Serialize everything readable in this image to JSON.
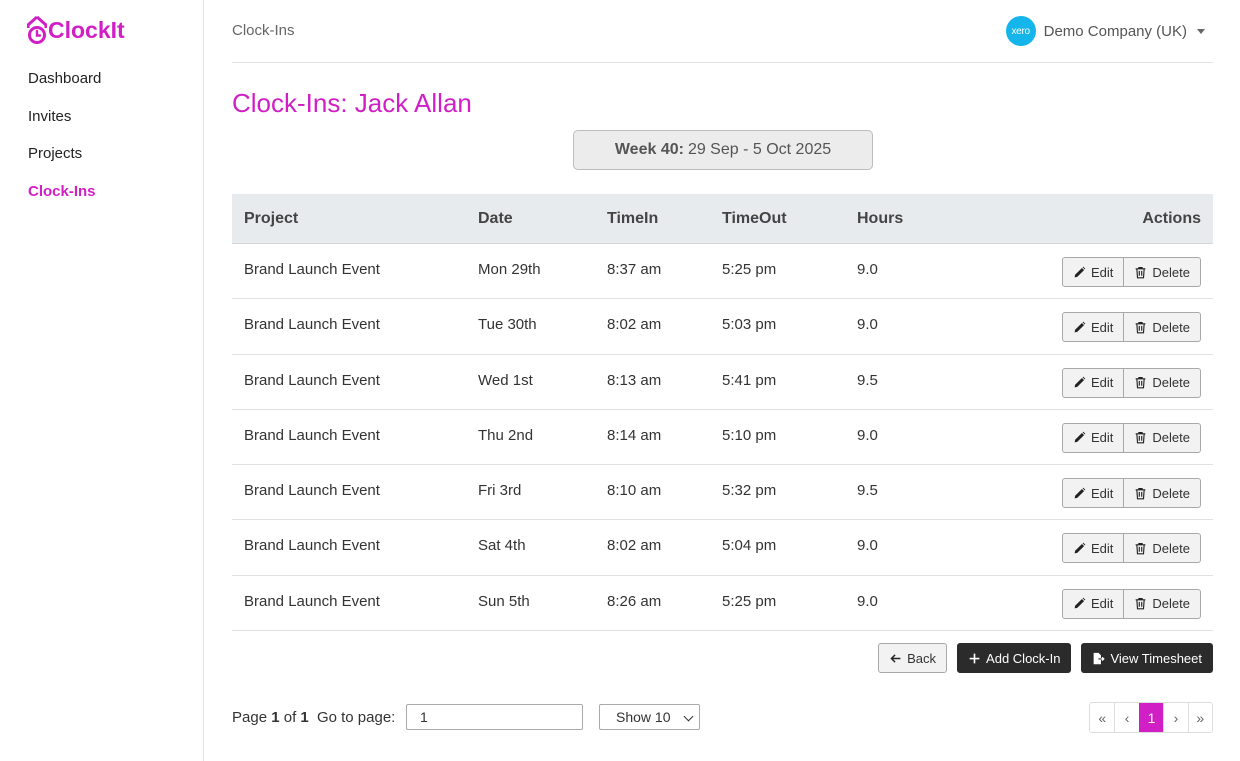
{
  "app": {
    "name": "ClockIt",
    "brand_color": "#d11fc6"
  },
  "sidebar": {
    "items": [
      {
        "label": "Dashboard",
        "active": false
      },
      {
        "label": "Invites",
        "active": false
      },
      {
        "label": "Projects",
        "active": false
      },
      {
        "label": "Clock-Ins",
        "active": true
      }
    ]
  },
  "header": {
    "breadcrumb": "Clock-Ins",
    "company_logo_text": "xero",
    "company_name": "Demo Company (UK)"
  },
  "page": {
    "title": "Clock-Ins: Jack Allan",
    "week_label": "Week 40:",
    "week_range": "29 Sep - 5 Oct 2025"
  },
  "table": {
    "columns": [
      "Project",
      "Date",
      "TimeIn",
      "TimeOut",
      "Hours",
      "Actions"
    ],
    "edit_label": "Edit",
    "delete_label": "Delete",
    "rows": [
      {
        "project": "Brand Launch Event",
        "date": "Mon 29th",
        "time_in": "8:37 am",
        "time_out": "5:25 pm",
        "hours": "9.0"
      },
      {
        "project": "Brand Launch Event",
        "date": "Tue 30th",
        "time_in": "8:02 am",
        "time_out": "5:03 pm",
        "hours": "9.0"
      },
      {
        "project": "Brand Launch Event",
        "date": "Wed 1st",
        "time_in": "8:13 am",
        "time_out": "5:41 pm",
        "hours": "9.5"
      },
      {
        "project": "Brand Launch Event",
        "date": "Thu 2nd",
        "time_in": "8:14 am",
        "time_out": "5:10 pm",
        "hours": "9.0"
      },
      {
        "project": "Brand Launch Event",
        "date": "Fri 3rd",
        "time_in": "8:10 am",
        "time_out": "5:32 pm",
        "hours": "9.5"
      },
      {
        "project": "Brand Launch Event",
        "date": "Sat 4th",
        "time_in": "8:02 am",
        "time_out": "5:04 pm",
        "hours": "9.0"
      },
      {
        "project": "Brand Launch Event",
        "date": "Sun 5th",
        "time_in": "8:26 am",
        "time_out": "5:25 pm",
        "hours": "9.0"
      }
    ]
  },
  "actions": {
    "back_label": "Back",
    "add_label": "Add Clock-In",
    "timesheet_label": "View Timesheet"
  },
  "pager": {
    "page_word": "Page",
    "current": "1",
    "of_word": "of",
    "total": "1",
    "goto_label": "Go to page:",
    "goto_value": "1",
    "show_label": "Show 10",
    "buttons": [
      "«",
      "‹",
      "1",
      "›",
      "»"
    ]
  }
}
